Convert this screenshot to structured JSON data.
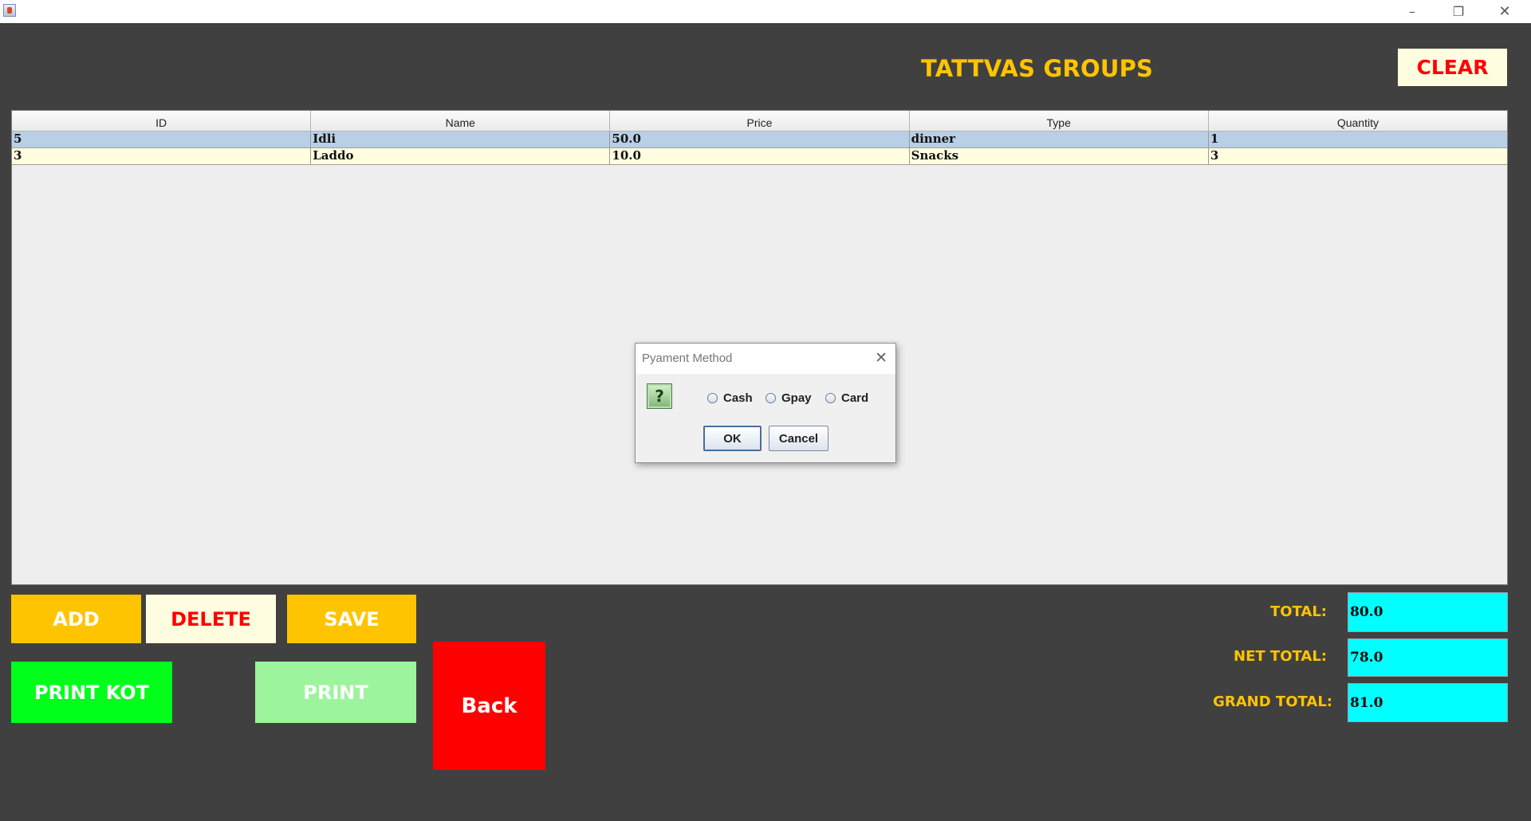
{
  "window": {
    "minimize_glyph": "–",
    "restore_glyph": "❐",
    "close_glyph": "✕"
  },
  "header": {
    "title": "TATTVAS GROUPS",
    "clear_label": "CLEAR"
  },
  "table": {
    "columns": [
      "ID",
      "Name",
      "Price",
      "Type",
      "Quantity"
    ],
    "rows": [
      [
        "5",
        "Idli",
        "50.0",
        "dinner",
        "1"
      ],
      [
        "3",
        "Laddo",
        "10.0",
        "Snacks",
        "3"
      ]
    ],
    "selected_row": 0
  },
  "dialog": {
    "title": "Pyament Method",
    "close_glyph": "✕",
    "icon": "question-icon",
    "icon_glyph": "?",
    "options": [
      "Cash",
      "Gpay",
      "Card"
    ],
    "ok_label": "OK",
    "cancel_label": "Cancel"
  },
  "buttons": {
    "add": "ADD",
    "delete": "DELETE",
    "save": "SAVE",
    "print_kot": "PRINT KOT",
    "print": "PRINT",
    "back": "Back"
  },
  "totals": {
    "total_label": "TOTAL:",
    "total_value": "80.0",
    "net_label": "NET TOTAL:",
    "net_value": "78.0",
    "grand_label": "GRAND TOTAL:",
    "grand_value": "81.0"
  },
  "colors": {
    "background": "#404040",
    "accent_yellow": "#ffc400",
    "danger_red": "#ff0000",
    "field_cyan": "#00ffff",
    "print_kot_green": "#00ff1a"
  }
}
